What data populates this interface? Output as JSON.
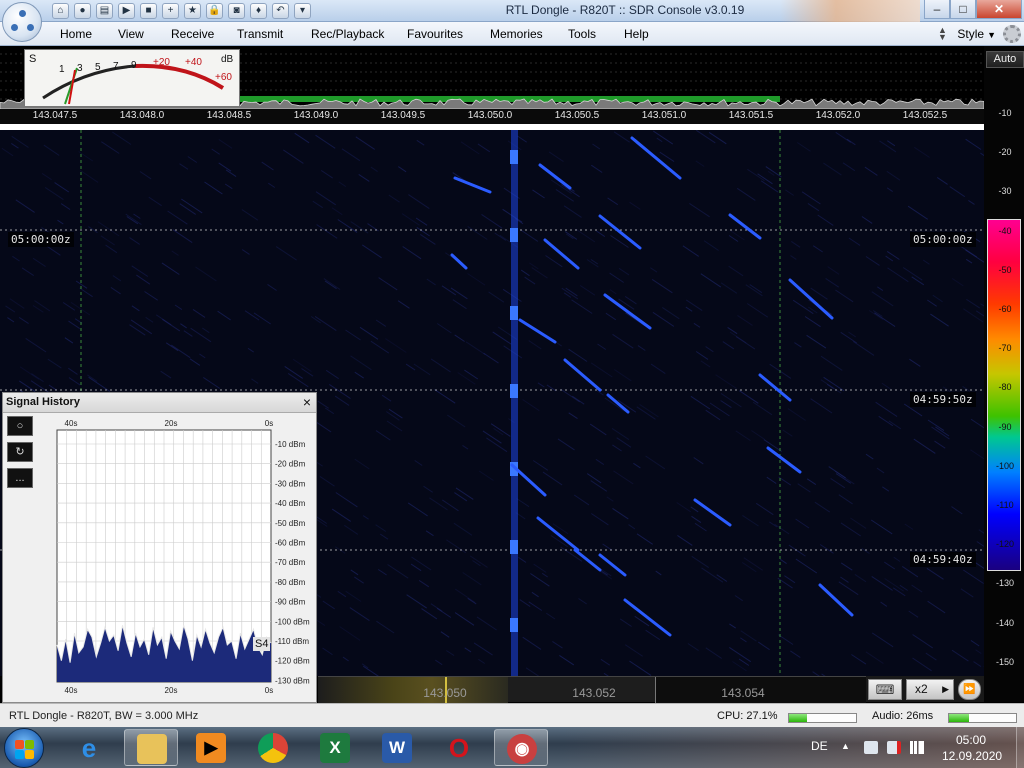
{
  "window": {
    "title": "RTL Dongle - R820T :: SDR Console v3.0.19"
  },
  "title_controls": {
    "minimize": "–",
    "maximize": "□",
    "close": "✕"
  },
  "quick_access": [
    "home-icon",
    "record-icon",
    "open-folder-icon",
    "play-icon",
    "stop-icon",
    "add-icon",
    "favourite-star-icon",
    "lock-icon",
    "camera-icon",
    "pin-icon",
    "undo-icon",
    "dropdown-icon"
  ],
  "menu": {
    "items": [
      "Home",
      "View",
      "Receive",
      "Transmit",
      "Rec/Playback",
      "Favourites",
      "Memories",
      "Tools",
      "Help"
    ],
    "style": "Style"
  },
  "smeter": {
    "s_label": "S",
    "db_label": "dB",
    "scale_s": [
      "1",
      "3",
      "5",
      "7",
      "9"
    ],
    "scale_db": [
      "+20",
      "+40",
      "+60"
    ]
  },
  "spectrum": {
    "freq_labels": [
      "143.047.5",
      "143.048.0",
      "143.048.5",
      "143.049.0",
      "143.049.5",
      "143.050.0",
      "143.050.5",
      "143.051.0",
      "143.051.5",
      "143.052.0",
      "143.052.5"
    ]
  },
  "scale": {
    "auto_label": "Auto",
    "ticks": [
      "-10",
      "-20",
      "-30",
      "-40",
      "-50",
      "-60",
      "-70",
      "-80",
      "-90",
      "-100",
      "-110",
      "-120",
      "-130",
      "-140",
      "-150"
    ]
  },
  "waterfall": {
    "time_markers": [
      {
        "left": "05:00:00z",
        "right": "05:00:00z"
      },
      {
        "right": "04:59:50z"
      },
      {
        "right": "04:59:40z"
      }
    ]
  },
  "signal_history": {
    "title": "Signal History",
    "close": "×",
    "tools": [
      "circle-tool-icon",
      "refresh-tool-icon",
      "more-tool-icon"
    ],
    "more_label": "...",
    "top_labels": [
      "40s",
      "20s",
      "0s"
    ],
    "bottom_labels": [
      "40s",
      "20s",
      "0s"
    ],
    "y_labels": [
      "-10 dBm",
      "-20 dBm",
      "-30 dBm",
      "-40 dBm",
      "-50 dBm",
      "-60 dBm",
      "-70 dBm",
      "-80 dBm",
      "-90 dBm",
      "-100 dBm",
      "-110 dBm",
      "-120 dBm",
      "-130 dBm"
    ],
    "s_reading": "S4",
    "trace_dbm": [
      -112,
      -120,
      -109,
      -121,
      -106,
      -116,
      -113,
      -104,
      -108,
      -118,
      -111,
      -103,
      -110,
      -107,
      -115,
      -102,
      -111,
      -118,
      -106,
      -113,
      -109,
      -117,
      -103,
      -112,
      -108,
      -119,
      -105,
      -110,
      -114,
      -102,
      -109,
      -120,
      -107,
      -113,
      -104,
      -111,
      -116,
      -108,
      -103,
      -112,
      -110,
      -119,
      -106,
      -114,
      -109,
      -104,
      -113,
      -117,
      -108,
      -111
    ]
  },
  "ruler": {
    "labels": [
      "143.050",
      "143.052",
      "143.054"
    ]
  },
  "controls": {
    "keyboard": "⌨",
    "zoom": "x2",
    "zoom_arrow": "▶",
    "scroll": "⏩"
  },
  "status": {
    "left": "RTL Dongle - R820T, BW = 3.000 MHz",
    "cpu": "CPU: 27.1%",
    "cpu_fraction": 0.27,
    "audio": "Audio: 26ms",
    "audio_fraction": 0.3
  },
  "taskbar": {
    "apps": [
      {
        "name": "internet-explorer",
        "icon": "e",
        "color": "#2e8ee6"
      },
      {
        "name": "file-explorer",
        "icon": "",
        "color": "#e8c25a"
      },
      {
        "name": "media-player",
        "icon": "▶",
        "color": "#f08a20"
      },
      {
        "name": "chrome",
        "icon": "",
        "color": "#ffffff"
      },
      {
        "name": "excel",
        "icon": "X",
        "color": "#1e7a3e"
      },
      {
        "name": "word",
        "icon": "W",
        "color": "#2a5aa8"
      },
      {
        "name": "opera",
        "icon": "O",
        "color": "#d4141c"
      },
      {
        "name": "sdr-console",
        "icon": "◉",
        "color": "#c84040"
      }
    ],
    "lang": "DE",
    "time": "05:00",
    "date": "12.09.2020"
  },
  "colors": {
    "accent": "#1a3fd8",
    "signal": "#2a66ff",
    "waterfall_bg": "#050818"
  }
}
